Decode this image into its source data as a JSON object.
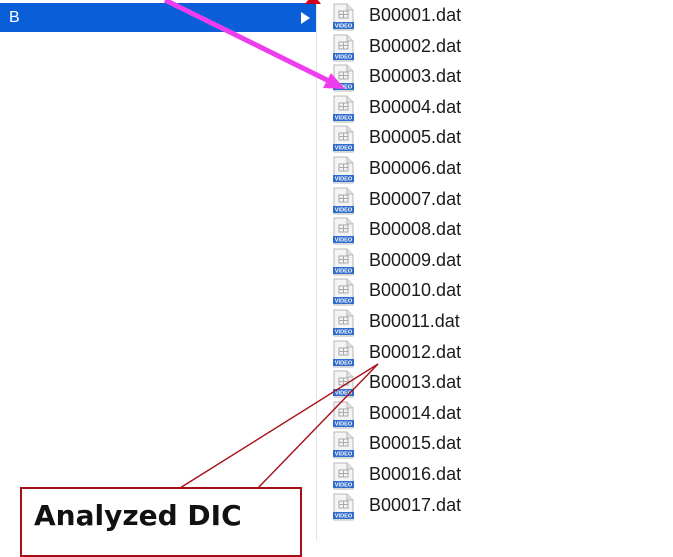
{
  "finder": {
    "selected_folder": "B",
    "files": [
      "B00001.dat",
      "B00002.dat",
      "B00003.dat",
      "B00004.dat",
      "B00005.dat",
      "B00006.dat",
      "B00007.dat",
      "B00008.dat",
      "B00009.dat",
      "B00010.dat",
      "B00011.dat",
      "B00012.dat",
      "B00013.dat",
      "B00014.dat",
      "B00015.dat",
      "B00016.dat",
      "B00017.dat"
    ],
    "file_icon_badge": "VIDEO"
  },
  "annotation": {
    "callout_text": "Analyzed DIC",
    "callout_color": "#a70f16",
    "arrow_color": "#ee3ded",
    "selection_color": "#0a5fd8"
  }
}
